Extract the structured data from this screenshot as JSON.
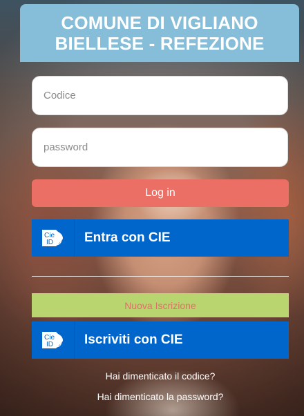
{
  "header": {
    "title_line1": "COMUNE DI VIGLIANO",
    "title_line2": "BIELLESE - REFEZIONE",
    "background_color": "#86bdd9"
  },
  "form": {
    "code_placeholder": "Codice",
    "code_value": "",
    "password_placeholder": "password",
    "password_value": ""
  },
  "buttons": {
    "login_label": "Log in",
    "login_color": "#eb6f65",
    "cie_login_label": "Entra con CIE",
    "new_registration_label": "Nuova Iscrizione",
    "new_registration_color": "#b9d56f",
    "cie_register_label": "Iscriviti con CIE",
    "cie_color": "#0066cc"
  },
  "cie_logo": {
    "icon": "cie-id-icon",
    "line1": "Cie",
    "line2": "ID"
  },
  "links": {
    "forgot_code": "Hai dimenticato il codice?",
    "forgot_password": "Hai dimenticato la password?"
  }
}
